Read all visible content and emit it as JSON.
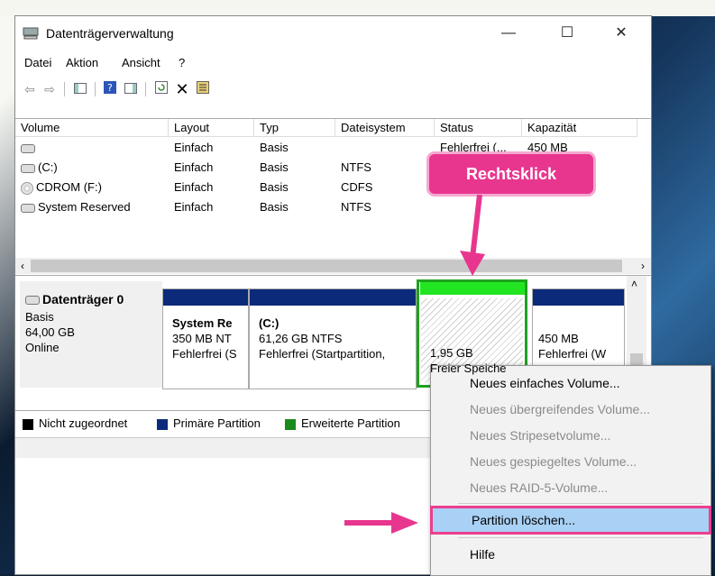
{
  "window": {
    "title": "Datenträgerverwaltung",
    "minimize": "—",
    "maximize": "☐",
    "close": "✕"
  },
  "menu": [
    "Datei",
    "Aktion",
    "Ansicht",
    "?"
  ],
  "volume_table": {
    "headers": [
      "Volume",
      "Layout",
      "Typ",
      "Dateisystem",
      "Status",
      "Kapazität"
    ],
    "rows": [
      {
        "volume": "",
        "layout": "Einfach",
        "typ": "Basis",
        "fs": "",
        "status": "Fehlerfrei (...",
        "kap": "450 MB"
      },
      {
        "volume": "(C:)",
        "layout": "Einfach",
        "typ": "Basis",
        "fs": "NTFS",
        "status": "",
        "kap": ""
      },
      {
        "volume": "CDROM (F:)",
        "layout": "Einfach",
        "typ": "Basis",
        "fs": "CDFS",
        "status": "",
        "kap": ""
      },
      {
        "volume": "System Reserved",
        "layout": "Einfach",
        "typ": "Basis",
        "fs": "NTFS",
        "status": "",
        "kap": ""
      }
    ]
  },
  "disk": {
    "title": "Datenträger 0",
    "type": "Basis",
    "size": "64,00 GB",
    "state": "Online",
    "partitions": [
      {
        "name": "System Re",
        "size": "350 MB NT",
        "status": "Fehlerfrei (S"
      },
      {
        "name": "(C:)",
        "size": "61,26 GB NTFS",
        "status": "Fehlerfrei (Startpartition,"
      },
      {
        "name": "",
        "size": "1,95 GB",
        "status": "Freier Speiche"
      },
      {
        "name": "",
        "size": "450 MB",
        "status": "Fehlerfrei (W"
      }
    ]
  },
  "legend": [
    {
      "label": "Nicht zugeordnet",
      "color": "#000000"
    },
    {
      "label": "Primäre Partition",
      "color": "#0b2a7a"
    },
    {
      "label": "Erweiterte Partition",
      "color": "#1a8a1a"
    }
  ],
  "context_menu": {
    "items": [
      {
        "label": "Neues einfaches Volume...",
        "enabled": true
      },
      {
        "label": "Neues übergreifendes Volume...",
        "enabled": false
      },
      {
        "label": "Neues Stripesetvolume...",
        "enabled": false
      },
      {
        "label": "Neues gespiegeltes Volume...",
        "enabled": false
      },
      {
        "label": "Neues RAID-5-Volume...",
        "enabled": false
      },
      {
        "label": "Partition löschen...",
        "enabled": true,
        "highlighted": true
      },
      {
        "label": "Hilfe",
        "enabled": true
      }
    ]
  },
  "callout": {
    "text": "Rechtsklick",
    "color": "#e8368f"
  }
}
